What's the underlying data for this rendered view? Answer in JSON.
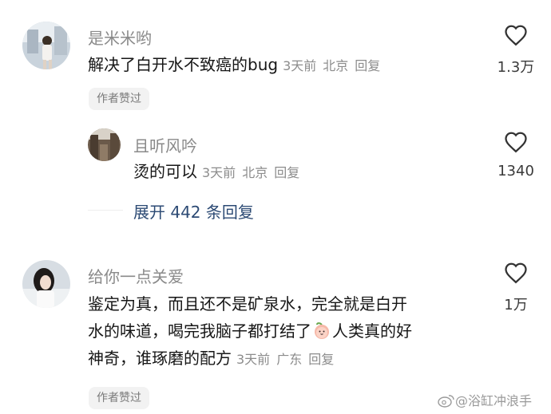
{
  "comments": [
    {
      "username": "是米米哟",
      "text": "解决了白开水不致癌的bug",
      "time": "3天前",
      "location": "北京",
      "reply_label": "回复",
      "likes": "1.3万",
      "badge": "作者赞过",
      "reply": {
        "username": "且听风吟",
        "text": "烫的可以",
        "time": "3天前",
        "location": "北京",
        "reply_label": "回复",
        "likes": "1340"
      },
      "expand_label": "展开 442 条回复"
    },
    {
      "username": "给你一点关爱",
      "text_lines": [
        "鉴定为真，而且还不是矿泉水，完全就是白开",
        "水的味道，喝完我脑子都打结了",
        "人类真的好",
        "神奇，谁琢磨的配方"
      ],
      "time": "3天前",
      "location": "广东",
      "reply_label": "回复",
      "likes": "1万",
      "badge": "作者赞过"
    }
  ],
  "watermark": "@浴缸冲浪手",
  "colors": {
    "meta": "#8c8c8c",
    "link": "#2c4a74",
    "badge_bg": "#f2f2f2"
  }
}
